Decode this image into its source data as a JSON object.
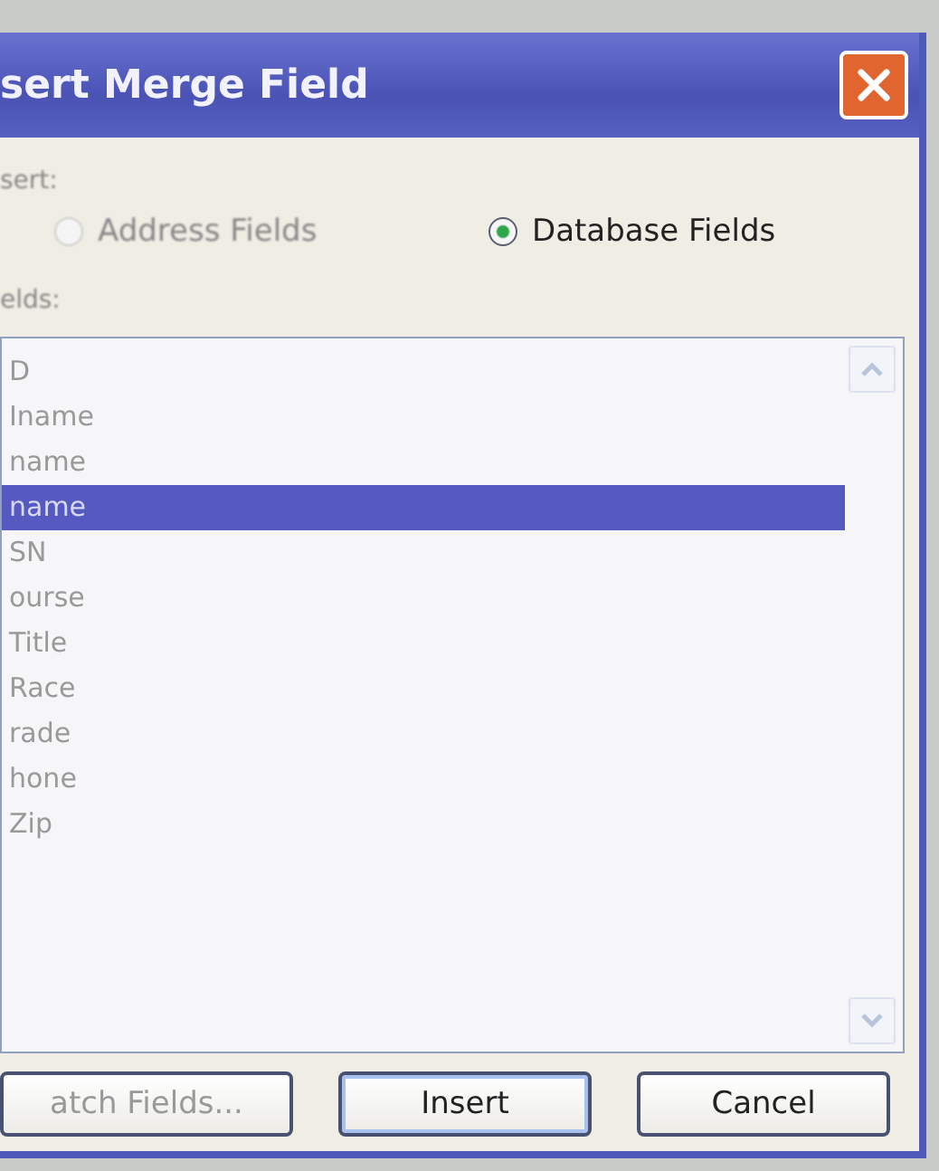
{
  "window": {
    "title": "sert Merge Field"
  },
  "insert": {
    "label": "sert:",
    "options": [
      {
        "label": "Address Fields",
        "selected": false
      },
      {
        "label": "Database Fields",
        "selected": true
      }
    ]
  },
  "fields": {
    "label": "elds:",
    "items": [
      {
        "label": "D",
        "selected": false
      },
      {
        "label": "Iname",
        "selected": false
      },
      {
        "label": "name",
        "selected": false
      },
      {
        "label": "name",
        "selected": true
      },
      {
        "label": "SN",
        "selected": false
      },
      {
        "label": "ourse",
        "selected": false
      },
      {
        "label": "Title",
        "selected": false
      },
      {
        "label": "Race",
        "selected": false
      },
      {
        "label": "rade",
        "selected": false
      },
      {
        "label": "hone",
        "selected": false
      },
      {
        "label": "Zip",
        "selected": false
      }
    ]
  },
  "buttons": [
    {
      "label": "atch Fields...",
      "kind": "plain"
    },
    {
      "label": "Insert",
      "kind": "default"
    },
    {
      "label": "Cancel",
      "kind": "plain"
    }
  ]
}
